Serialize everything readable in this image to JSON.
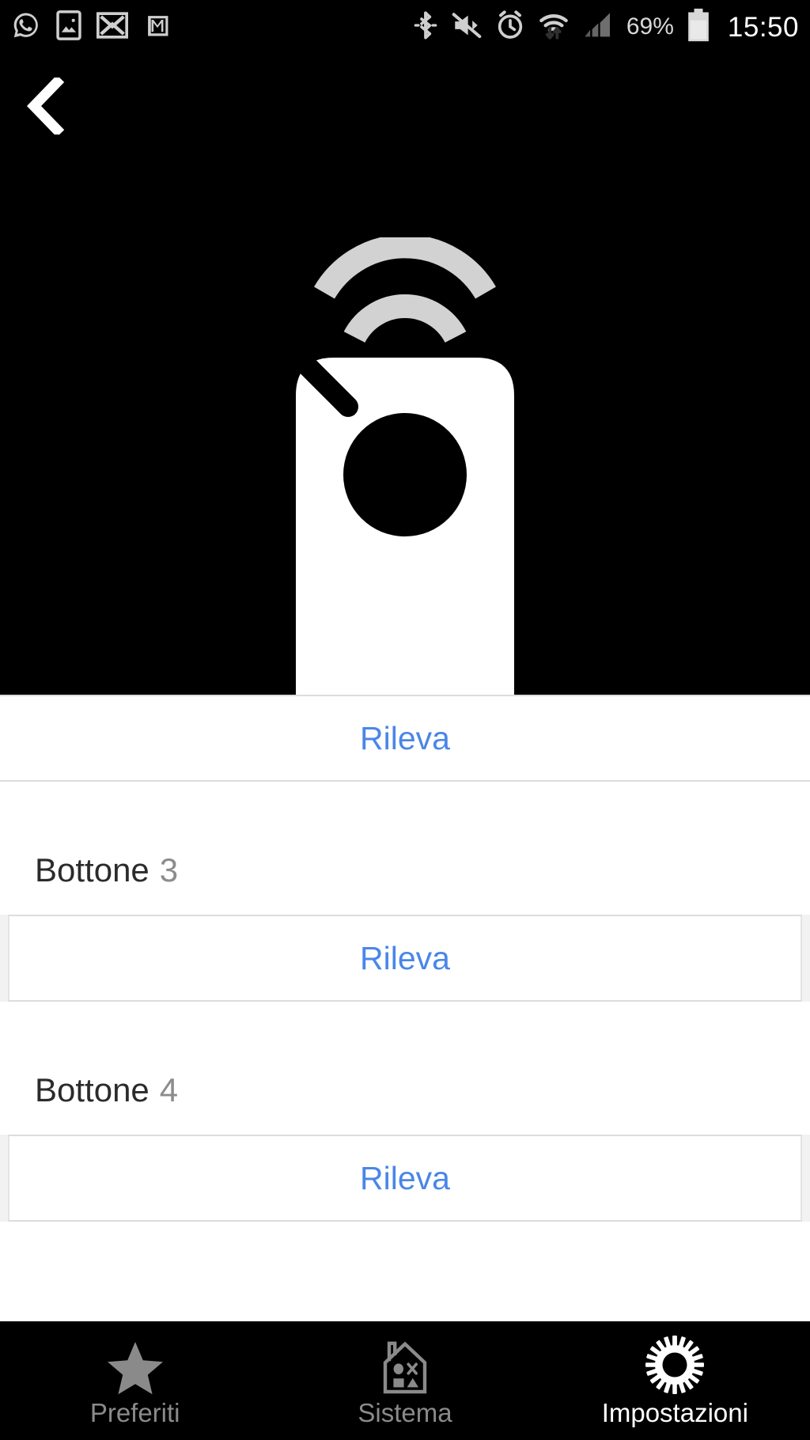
{
  "status_bar": {
    "left_icons": [
      {
        "name": "whatsapp-icon",
        "label": "WhatsApp"
      },
      {
        "name": "gallery-icon",
        "label": "Gallery"
      },
      {
        "name": "mail-x-icon",
        "label": "Mail"
      },
      {
        "name": "gmail-icon",
        "label": "Gmail"
      }
    ],
    "right_icons": [
      {
        "name": "bluetooth-icon",
        "label": "Bluetooth"
      },
      {
        "name": "mute-icon",
        "label": "Silent"
      },
      {
        "name": "alarm-icon",
        "label": "Alarm"
      },
      {
        "name": "wifi-icon",
        "label": "Wi-Fi"
      },
      {
        "name": "signal-icon",
        "label": "Signal"
      }
    ],
    "battery_percent": "69%",
    "time": "15:50"
  },
  "header": {
    "back_icon": "chevron-left-icon"
  },
  "hero": {
    "device_icon": "ir-remote-icon"
  },
  "list": {
    "rows": [
      {
        "type": "action",
        "label": "Rileva",
        "name": "detect-button-2"
      },
      {
        "type": "group",
        "name": "Bottone",
        "number": "3"
      },
      {
        "type": "action",
        "label": "Rileva",
        "name": "detect-button-3"
      },
      {
        "type": "group",
        "name": "Bottone",
        "number": "4"
      },
      {
        "type": "action",
        "label": "Rileva",
        "name": "detect-button-4"
      }
    ]
  },
  "tabbar": {
    "tabs": [
      {
        "label": "Preferiti",
        "icon": "star-icon",
        "active": false
      },
      {
        "label": "Sistema",
        "icon": "home-icon",
        "active": false
      },
      {
        "label": "Impostazioni",
        "icon": "gear-icon",
        "active": true
      }
    ]
  },
  "colors": {
    "accent_blue": "#4a86e8",
    "bg_black": "#000000",
    "bg_white": "#ffffff",
    "divider": "#dcdcdc",
    "inactive_tab": "#8a8a8a",
    "muted_text": "#8c8c8c"
  }
}
